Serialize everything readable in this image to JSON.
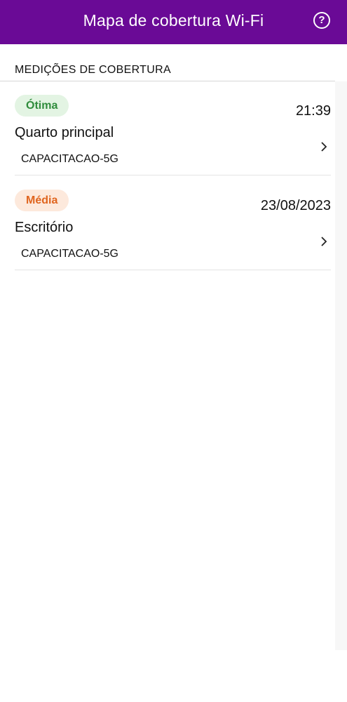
{
  "header": {
    "title": "Mapa de cobertura Wi-Fi",
    "help_label": "?",
    "color": "#6a0a96"
  },
  "section": {
    "title": "MEDIÇÕES DE COBERTURA"
  },
  "measurements": [
    {
      "quality": "Ótima",
      "quality_color": "#2f8c3c",
      "time": "21:39",
      "room": "Quarto principal",
      "ssid": "CAPACITACAO-5G"
    },
    {
      "quality": "Média",
      "quality_color": "#e0651f",
      "time": "23/08/2023",
      "room": "Escritório",
      "ssid": "CAPACITACAO-5G"
    }
  ],
  "icons": {
    "help": "help-circle-icon",
    "chevron": "chevron-right-icon"
  }
}
